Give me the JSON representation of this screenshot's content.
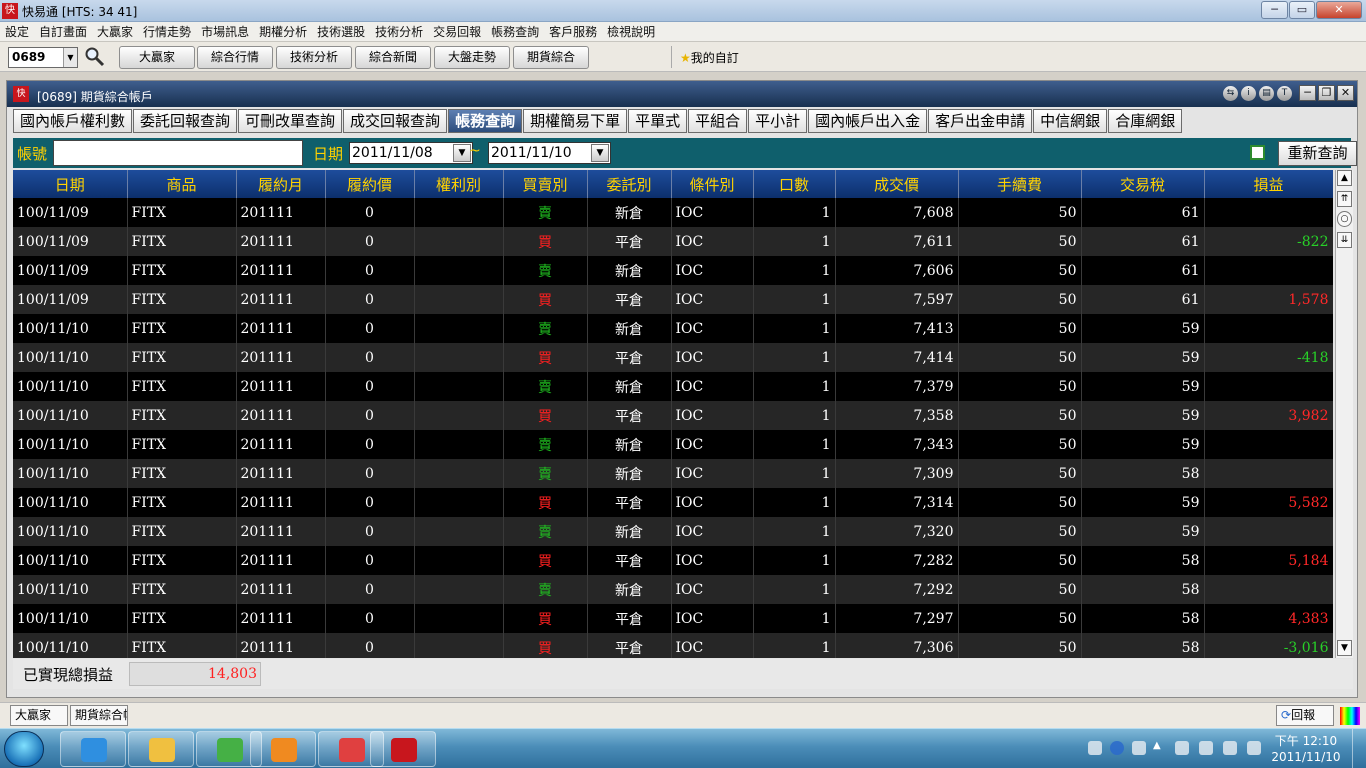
{
  "app": {
    "title": "快易通 [HTS: 34 41]",
    "logo_text": "快"
  },
  "menu": [
    "設定",
    "自訂畫面",
    "大贏家",
    "行情走勢",
    "市場訊息",
    "期權分析",
    "技術選股",
    "技術分析",
    "交易回報",
    "帳務查詢",
    "客戶服務",
    "檢視說明"
  ],
  "toolbar": {
    "stock_code": "0689",
    "buttons": [
      "大贏家",
      "綜合行情",
      "技術分析",
      "綜合新聞",
      "大盤走勢",
      "期貨綜合"
    ],
    "favorites": "我的自訂"
  },
  "window": {
    "title": "[0689] 期貨綜合帳戶"
  },
  "tabs": [
    {
      "label": "國內帳戶權利數",
      "active": false
    },
    {
      "label": "委託回報查詢",
      "active": false
    },
    {
      "label": "可刪改單查詢",
      "active": false
    },
    {
      "label": "成交回報查詢",
      "active": false
    },
    {
      "label": "帳務查詢",
      "active": true
    },
    {
      "label": "期權簡易下單",
      "active": false
    },
    {
      "label": "平單式",
      "active": false
    },
    {
      "label": "平組合",
      "active": false
    },
    {
      "label": "平小計",
      "active": false
    },
    {
      "label": "國內帳戶出入金",
      "active": false
    },
    {
      "label": "客戶出金申請",
      "active": false
    },
    {
      "label": "中信網銀",
      "active": false
    },
    {
      "label": "合庫網銀",
      "active": false
    }
  ],
  "query": {
    "account_label": "帳號",
    "account_value": "",
    "date_label": "日期",
    "date_from": "2011/11/08",
    "tilde": "~",
    "date_to": "2011/11/10",
    "requery": "重新查詢"
  },
  "table": {
    "headers": [
      "日期",
      "商品",
      "履約月",
      "履約價",
      "權利別",
      "買賣別",
      "委託別",
      "條件別",
      "口數",
      "成交價",
      "手續費",
      "交易稅",
      "損益"
    ],
    "rows": [
      [
        "100/11/09",
        "FITX",
        "201111",
        "0",
        "",
        "賣",
        "新倉",
        "IOC",
        "1",
        "7,608",
        "50",
        "61",
        ""
      ],
      [
        "100/11/09",
        "FITX",
        "201111",
        "0",
        "",
        "買",
        "平倉",
        "IOC",
        "1",
        "7,611",
        "50",
        "61",
        "-822"
      ],
      [
        "100/11/09",
        "FITX",
        "201111",
        "0",
        "",
        "賣",
        "新倉",
        "IOC",
        "1",
        "7,606",
        "50",
        "61",
        ""
      ],
      [
        "100/11/09",
        "FITX",
        "201111",
        "0",
        "",
        "買",
        "平倉",
        "IOC",
        "1",
        "7,597",
        "50",
        "61",
        "1,578"
      ],
      [
        "100/11/10",
        "FITX",
        "201111",
        "0",
        "",
        "賣",
        "新倉",
        "IOC",
        "1",
        "7,413",
        "50",
        "59",
        ""
      ],
      [
        "100/11/10",
        "FITX",
        "201111",
        "0",
        "",
        "買",
        "平倉",
        "IOC",
        "1",
        "7,414",
        "50",
        "59",
        "-418"
      ],
      [
        "100/11/10",
        "FITX",
        "201111",
        "0",
        "",
        "賣",
        "新倉",
        "IOC",
        "1",
        "7,379",
        "50",
        "59",
        ""
      ],
      [
        "100/11/10",
        "FITX",
        "201111",
        "0",
        "",
        "買",
        "平倉",
        "IOC",
        "1",
        "7,358",
        "50",
        "59",
        "3,982"
      ],
      [
        "100/11/10",
        "FITX",
        "201111",
        "0",
        "",
        "賣",
        "新倉",
        "IOC",
        "1",
        "7,343",
        "50",
        "59",
        ""
      ],
      [
        "100/11/10",
        "FITX",
        "201111",
        "0",
        "",
        "賣",
        "新倉",
        "IOC",
        "1",
        "7,309",
        "50",
        "58",
        ""
      ],
      [
        "100/11/10",
        "FITX",
        "201111",
        "0",
        "",
        "買",
        "平倉",
        "IOC",
        "1",
        "7,314",
        "50",
        "59",
        "5,582"
      ],
      [
        "100/11/10",
        "FITX",
        "201111",
        "0",
        "",
        "賣",
        "新倉",
        "IOC",
        "1",
        "7,320",
        "50",
        "59",
        ""
      ],
      [
        "100/11/10",
        "FITX",
        "201111",
        "0",
        "",
        "買",
        "平倉",
        "IOC",
        "1",
        "7,282",
        "50",
        "58",
        "5,184"
      ],
      [
        "100/11/10",
        "FITX",
        "201111",
        "0",
        "",
        "賣",
        "新倉",
        "IOC",
        "1",
        "7,292",
        "50",
        "58",
        ""
      ],
      [
        "100/11/10",
        "FITX",
        "201111",
        "0",
        "",
        "買",
        "平倉",
        "IOC",
        "1",
        "7,297",
        "50",
        "58",
        "4,383"
      ],
      [
        "100/11/10",
        "FITX",
        "201111",
        "0",
        "",
        "買",
        "平倉",
        "IOC",
        "1",
        "7,306",
        "50",
        "58",
        "-3,016"
      ]
    ]
  },
  "summary": {
    "label": "已實現總損益",
    "value": "14,803"
  },
  "statusbar": {
    "tabs": [
      "大贏家",
      "期貨綜合帳戶"
    ],
    "report": "回報"
  },
  "clock": {
    "time": "下午 12:10",
    "date": "2011/11/10"
  },
  "colors": {
    "sell": "#20c020",
    "buy": "#ff2020",
    "profit": "#ff2828",
    "loss": "#28d028",
    "header_text": "#ffd200",
    "query_bg": "#0f5f6c"
  }
}
